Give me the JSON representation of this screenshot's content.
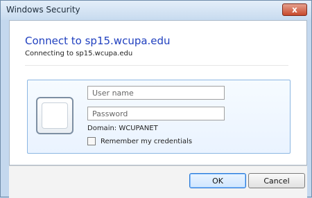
{
  "window": {
    "title": "Windows Security",
    "close_label": "x"
  },
  "dialog": {
    "heading": "Connect to sp15.wcupa.edu",
    "subheading": "Connecting to sp15.wcupa.edu"
  },
  "credentials": {
    "username_placeholder": "User name",
    "password_placeholder": "Password",
    "domain_text": "Domain: WCUPANET",
    "remember_label": "Remember my credentials"
  },
  "buttons": {
    "ok": "OK",
    "cancel": "Cancel"
  }
}
